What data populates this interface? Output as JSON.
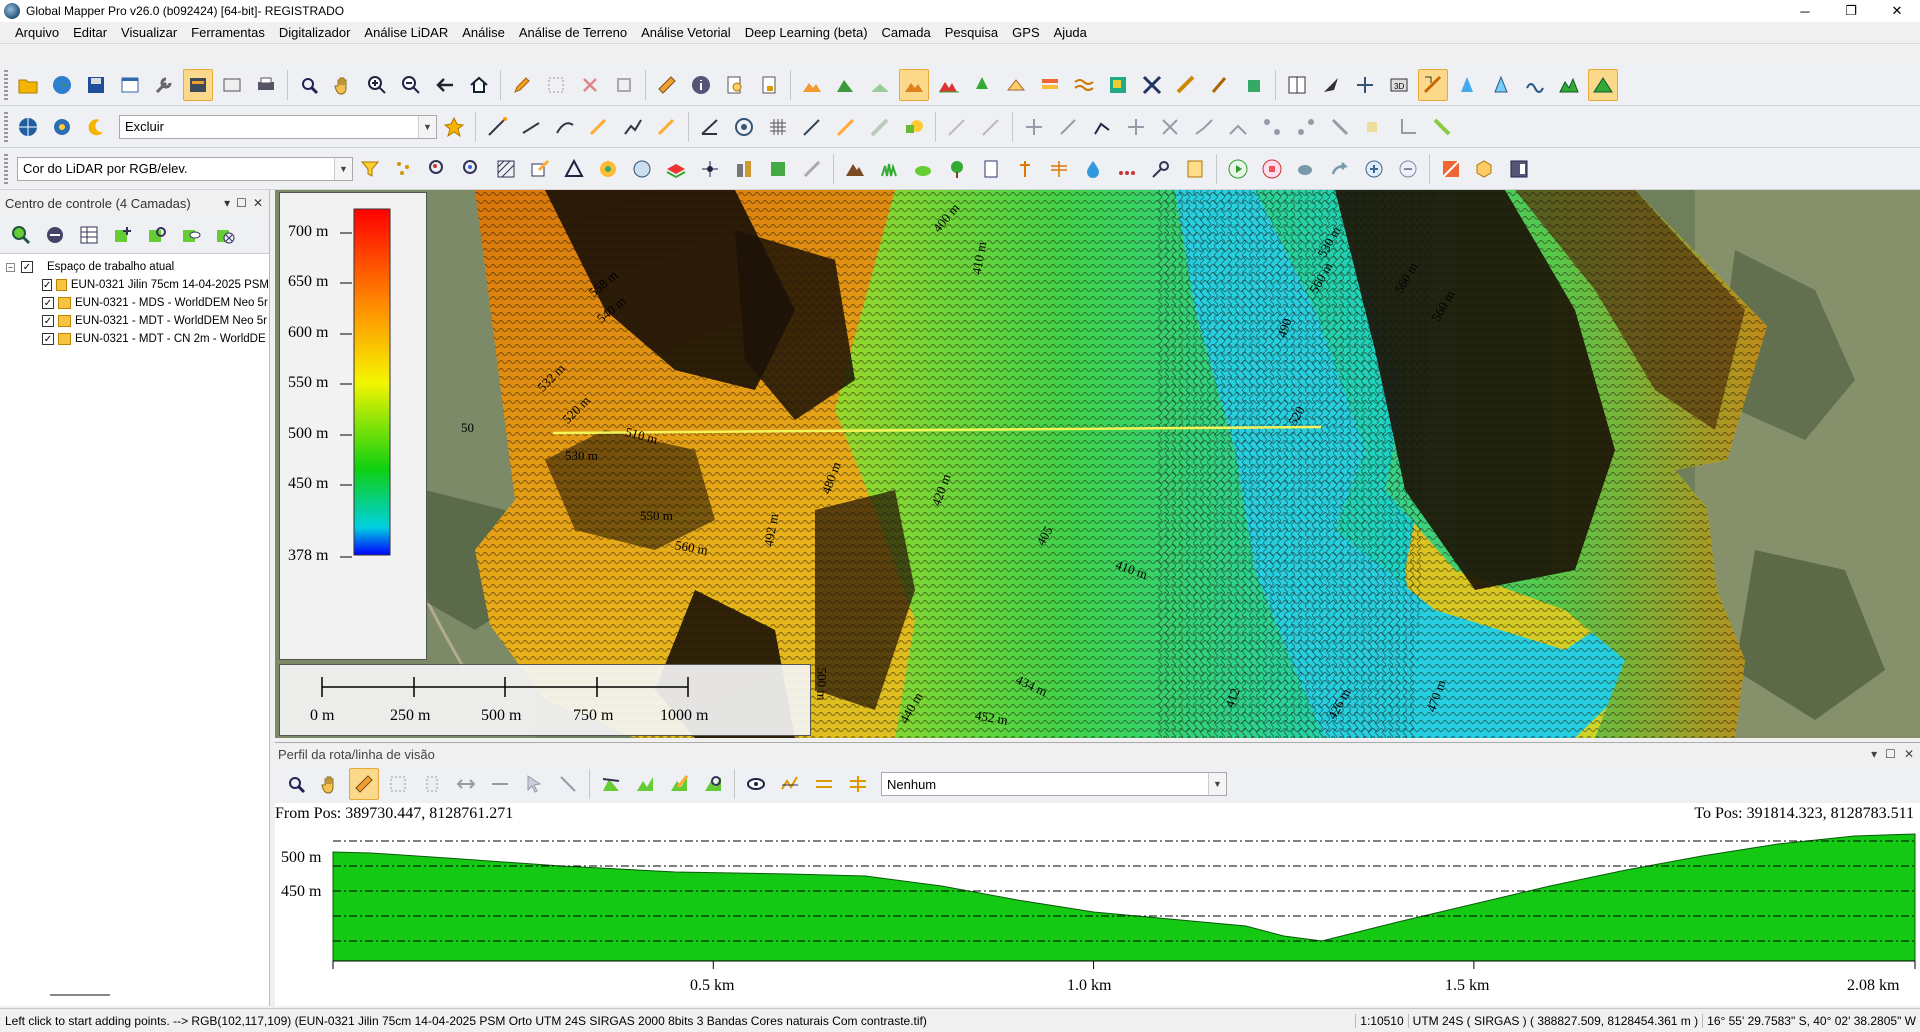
{
  "window": {
    "title": "Global Mapper Pro v26.0 (b092424) [64-bit]- REGISTRADO",
    "min": "─",
    "max": "❐",
    "close": "✕"
  },
  "menu": [
    "Arquivo",
    "Editar",
    "Visualizar",
    "Ferramentas",
    "Digitalizador",
    "Análise LiDAR",
    "Análise",
    "Análise de Terreno",
    "Análise Vetorial",
    "Deep Learning (beta)",
    "Camada",
    "Pesquisa",
    "GPS",
    "Ajuda"
  ],
  "toolbar": {
    "row2_dropdown": "Excluir",
    "row3_dropdown": "Cor do LiDAR por RGB/elev."
  },
  "control_center": {
    "title": "Centro de controle (4 Camadas)",
    "workspace": "Espaço de trabalho atual",
    "layers": [
      "EUN-0321 Jilin 75cm 14-04-2025 PSM",
      "EUN-0321 - MDS - WorldDEM Neo 5r",
      "EUN-0321 - MDT - WorldDEM Neo 5r",
      "EUN-0321 - MDT - CN 2m - WorldDE"
    ]
  },
  "legend": {
    "labels": [
      "700 m",
      "650 m",
      "600 m",
      "550 m",
      "500 m",
      "450 m",
      "378 m"
    ]
  },
  "scale_bar": {
    "labels": [
      "0 m",
      "250 m",
      "500 m",
      "750 m",
      "1000 m"
    ]
  },
  "contour_labels": [
    "400 m",
    "410 m",
    "558 m",
    "540 m",
    "532 m",
    "520 m",
    "550 m",
    "510 m",
    "530 m",
    "480 m",
    "492 m",
    "550 m",
    "560 m",
    "500 m",
    "420 m",
    "405",
    "410 m",
    "434 m",
    "452 m",
    "440 m",
    "412",
    "426 m",
    "470 m",
    "490",
    "520",
    "560 m",
    "530 m",
    "560 m",
    "560 m",
    "540 m",
    "50"
  ],
  "profile": {
    "title": "Perfil da rota/linha de visão",
    "dropdown": "Nenhum",
    "from": "From Pos: 389730.447, 8128761.271",
    "to": "To Pos: 391814.323, 8128783.511",
    "ylabels": [
      "500 m",
      "450 m"
    ],
    "xlabels": [
      "0.5 km",
      "1.0 km",
      "1.5 km",
      "2.08 km"
    ]
  },
  "profile_data": {
    "type": "area",
    "x_km": [
      0,
      0.05,
      0.15,
      0.3,
      0.45,
      0.6,
      0.7,
      0.8,
      0.9,
      1.0,
      1.1,
      1.2,
      1.25,
      1.3,
      1.4,
      1.5,
      1.6,
      1.7,
      1.8,
      1.9,
      2.0,
      2.08
    ],
    "y_m": [
      514,
      513,
      508,
      500,
      494,
      492,
      490,
      480,
      466,
      454,
      447,
      440,
      430,
      425,
      444,
      462,
      480,
      496,
      510,
      522,
      530,
      532
    ],
    "ylim": [
      405,
      535
    ],
    "xlim": [
      0,
      2.08
    ],
    "fill_color": "#14c814"
  },
  "status": {
    "hint": "Left click to start adding points. --> RGB(102,117,109) (EUN-0321 Jilin 75cm 14-04-2025 PSM Orto UTM 24S SIRGAS 2000 8bits 3 Bandas Cores naturais Com contraste.tif)",
    "scale": "1:10510",
    "proj": "UTM 24S ( SIRGAS ) ( 388827.509, 8128454.361 m )",
    "geo": "16° 55' 29.7583\" S, 40° 02' 38.2805\" W"
  }
}
